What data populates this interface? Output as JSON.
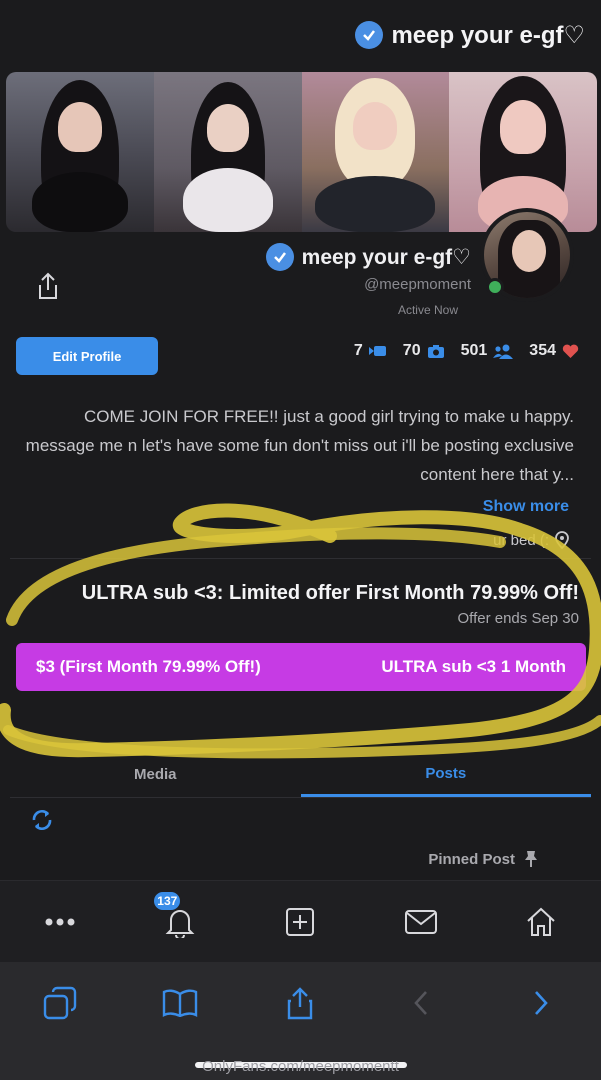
{
  "header": {
    "title": "meep your e-gf♡"
  },
  "profile": {
    "name": "meep your e-gf♡",
    "handle": "@meepmoment",
    "status": "Active Now",
    "edit_label": "Edit Profile"
  },
  "stats": {
    "likes": "354",
    "fans": "501",
    "photos": "70",
    "videos": "7"
  },
  "bio": {
    "text": "COME JOIN FOR FREE!! just a good girl trying to make u happy. message me n let's have some fun  don't miss out i'll be posting exclusive content here that y...",
    "show_more": "Show more",
    "location": "ur bed (:"
  },
  "offer": {
    "title": "ULTRA sub <3: Limited offer First Month 79.99% Off!",
    "ends": "Offer ends Sep 30",
    "button_left": "ULTRA sub <3  1 Month",
    "button_right": "$3  (First Month 79.99% Off!)"
  },
  "tabs": [
    {
      "label": "Posts",
      "active": true
    },
    {
      "label": "Media",
      "active": false
    }
  ],
  "pinned_label": "Pinned Post",
  "notifications_count": "137",
  "browser": {
    "url": "OnlyFans.com/meepmomentt"
  },
  "colors": {
    "accent": "#3a8de8",
    "subscribe": "#c63be4",
    "background": "#1b1b1d",
    "highlight": "#d9c43a"
  }
}
